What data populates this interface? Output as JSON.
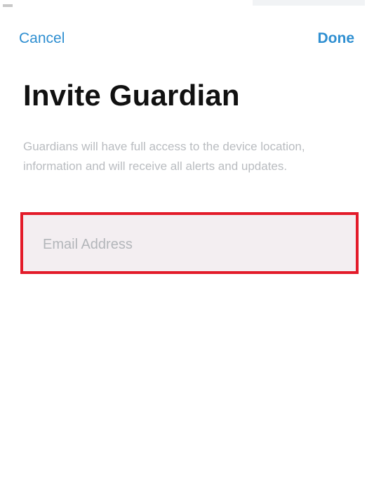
{
  "nav": {
    "cancel_label": "Cancel",
    "done_label": "Done"
  },
  "page": {
    "title": "Invite Guardian",
    "description": "Guardians will have full access to the device location, information and will receive all alerts and updates."
  },
  "email_field": {
    "value": "",
    "placeholder": "Email Address"
  },
  "colors": {
    "accent": "#2f8fd1",
    "highlight_border": "#e31b2a",
    "field_background": "#f3eef1"
  }
}
